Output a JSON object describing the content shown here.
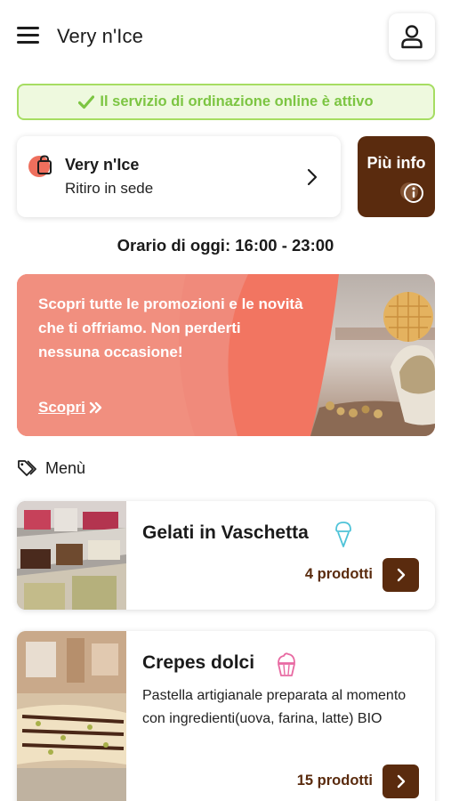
{
  "header": {
    "title": "Very n'Ice"
  },
  "status": {
    "text": "Il servizio di ordinazione online è attivo",
    "color": "#7cc542"
  },
  "store": {
    "name": "Very n'Ice",
    "mode": "Ritiro in sede",
    "icon": "shopping-bag-icon"
  },
  "info_button": {
    "label": "Più info",
    "icon": "info-icon",
    "color": "#5a2b0e"
  },
  "hours": {
    "text": "Orario di oggi: 16:00 - 23:00"
  },
  "promo": {
    "text": "Scopri tutte le promozioni e le novità che ti offriamo. Non perderti nessuna occasione!",
    "link_label": "Scopri",
    "color": "#f27561"
  },
  "menu": {
    "title": "Menù",
    "categories": [
      {
        "title": "Gelati in Vaschetta",
        "icon": "ice-cream-cone-icon",
        "description": "",
        "count": "4 prodotti"
      },
      {
        "title": "Crepes dolci",
        "icon": "cupcake-icon",
        "description": "Pastella artigianale preparata al momento con ingredienti(uova, farina, latte) BIO",
        "count": "15 prodotti"
      }
    ]
  }
}
